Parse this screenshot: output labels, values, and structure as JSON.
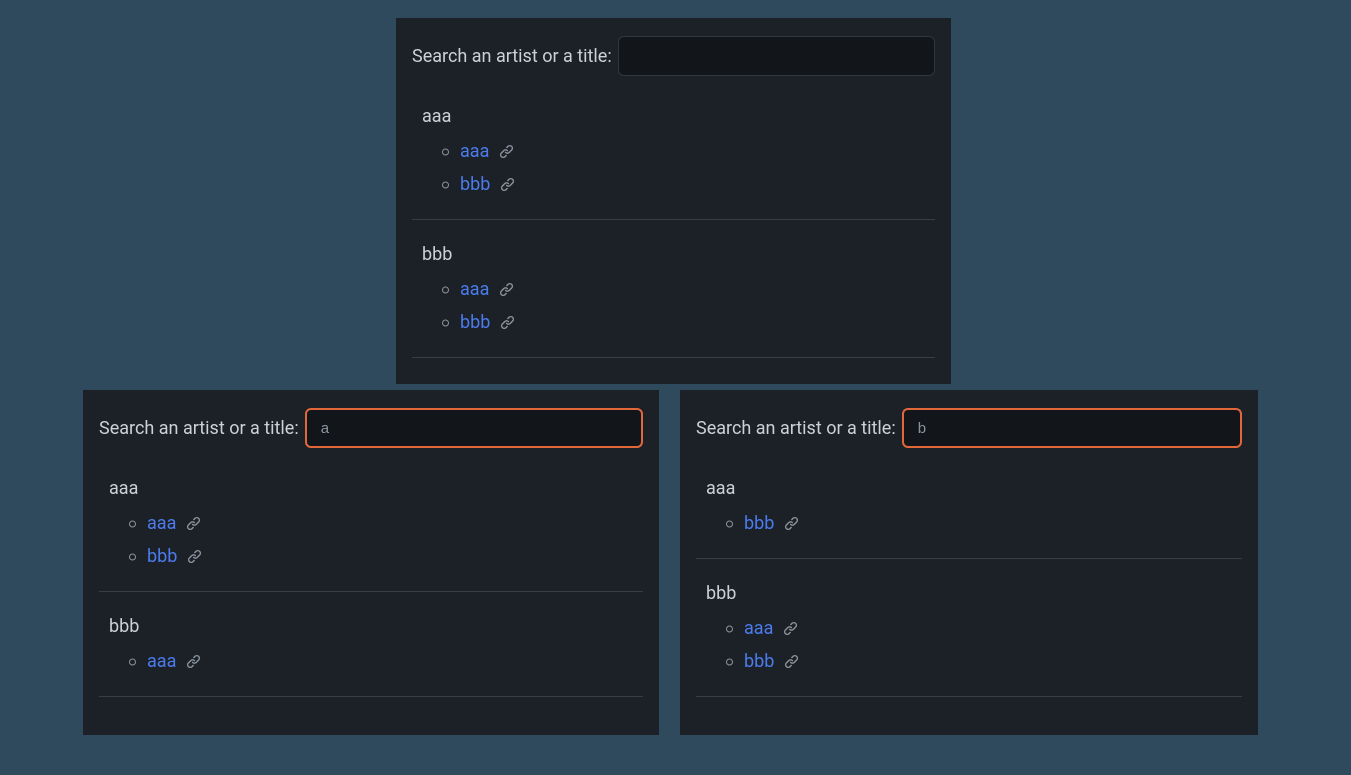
{
  "search_label": "Search an artist or a title:",
  "panels": {
    "top": {
      "input_value": "",
      "focused": false,
      "groups": [
        {
          "title": "aaa",
          "items": [
            "aaa",
            "bbb"
          ]
        },
        {
          "title": "bbb",
          "items": [
            "aaa",
            "bbb"
          ]
        }
      ]
    },
    "left": {
      "input_value": "a",
      "focused": true,
      "groups": [
        {
          "title": "aaa",
          "items": [
            "aaa",
            "bbb"
          ]
        },
        {
          "title": "bbb",
          "items": [
            "aaa"
          ]
        }
      ]
    },
    "right": {
      "input_value": "b",
      "focused": true,
      "groups": [
        {
          "title": "aaa",
          "items": [
            "bbb"
          ]
        },
        {
          "title": "bbb",
          "items": [
            "aaa",
            "bbb"
          ]
        }
      ]
    }
  }
}
